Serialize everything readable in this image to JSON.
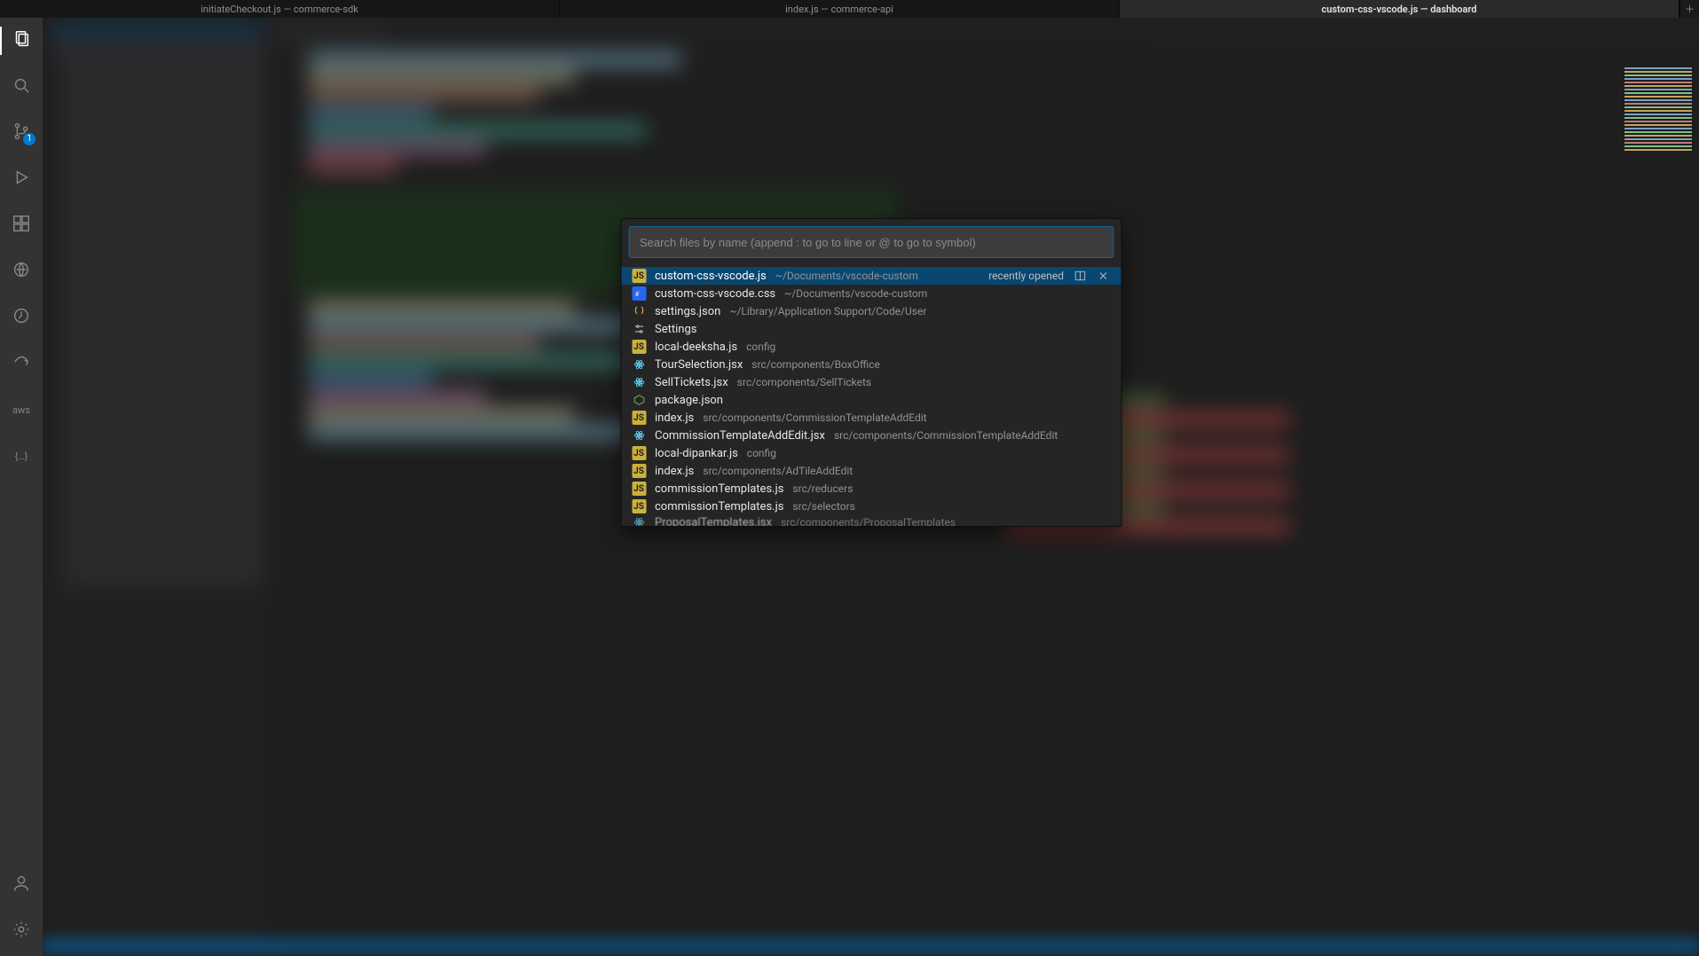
{
  "window": {
    "tabs": [
      {
        "label": "initiateCheckout.js — commerce-sdk",
        "active": false
      },
      {
        "label": "index.js — commerce-api",
        "active": false
      },
      {
        "label": "custom-css-vscode.js — dashboard",
        "active": true
      }
    ]
  },
  "activity": {
    "items": [
      {
        "name": "explorer",
        "active": true,
        "badge": null
      },
      {
        "name": "search",
        "active": false,
        "badge": null
      },
      {
        "name": "scm",
        "active": false,
        "badge": "1"
      },
      {
        "name": "run-debug",
        "active": false,
        "badge": null
      },
      {
        "name": "extensions",
        "active": false,
        "badge": null
      },
      {
        "name": "remote-explorer",
        "active": false,
        "badge": null
      },
      {
        "name": "timeline",
        "active": false,
        "badge": null
      },
      {
        "name": "share",
        "active": false,
        "badge": null
      }
    ],
    "aws_label": "aws",
    "braces_label": "{…}"
  },
  "quickopen": {
    "placeholder": "Search files by name (append : to go to line or @ to go to symbol)",
    "recently_label": "recently opened",
    "items": [
      {
        "icon": "js",
        "name": "custom-css-vscode.js",
        "path": "~/Documents/vscode-custom",
        "selected": true,
        "show_actions": true
      },
      {
        "icon": "css",
        "name": "custom-css-vscode.css",
        "path": "~/Documents/vscode-custom"
      },
      {
        "icon": "json",
        "name": "settings.json",
        "path": "~/Library/Application Support/Code/User"
      },
      {
        "icon": "settings",
        "name": "Settings",
        "path": ""
      },
      {
        "icon": "js",
        "name": "local-deeksha.js",
        "path": "config"
      },
      {
        "icon": "react",
        "name": "TourSelection.jsx",
        "path": "src/components/BoxOffice"
      },
      {
        "icon": "react",
        "name": "SellTickets.jsx",
        "path": "src/components/SellTickets"
      },
      {
        "icon": "node",
        "name": "package.json",
        "path": ""
      },
      {
        "icon": "js",
        "name": "index.js",
        "path": "src/components/CommissionTemplateAddEdit"
      },
      {
        "icon": "react",
        "name": "CommissionTemplateAddEdit.jsx",
        "path": "src/components/CommissionTemplateAddEdit"
      },
      {
        "icon": "js",
        "name": "local-dipankar.js",
        "path": "config"
      },
      {
        "icon": "js",
        "name": "index.js",
        "path": "src/components/AdTileAddEdit"
      },
      {
        "icon": "js",
        "name": "commissionTemplates.js",
        "path": "src/reducers"
      },
      {
        "icon": "js",
        "name": "commissionTemplates.js",
        "path": "src/selectors"
      },
      {
        "icon": "react",
        "name": "ProposalTemplates.jsx",
        "path": "src/components/ProposalTemplates",
        "cutoff": true
      }
    ]
  }
}
